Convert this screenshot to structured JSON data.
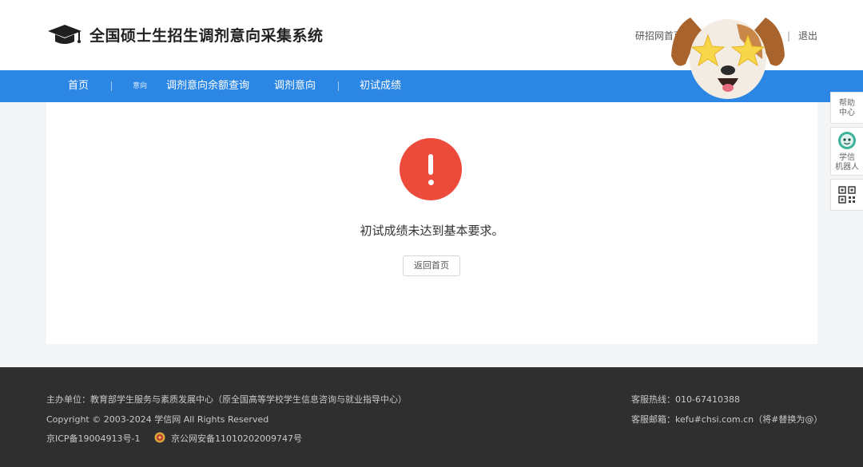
{
  "header": {
    "site_title": "全国硕士生招生调剂意向采集系统",
    "top_links": {
      "home": "研招网首页",
      "separator": "|",
      "logout": "退出"
    }
  },
  "nav": {
    "items": [
      {
        "label": "首页"
      },
      {
        "label": "意向"
      },
      {
        "label": "调剂意向余额查询"
      },
      {
        "label": "调剂意向"
      },
      {
        "label": "初试成绩"
      }
    ]
  },
  "main": {
    "message": "初试成绩未达到基本要求。",
    "back_button": "返回首页"
  },
  "side_tools": {
    "help_line1": "帮助",
    "help_line2": "中心",
    "robot_line1": "学信",
    "robot_line2": "机器人"
  },
  "footer": {
    "organizer": "主办单位：教育部学生服务与素质发展中心（原全国高等学校学生信息咨询与就业指导中心）",
    "copyright": "Copyright © 2003-2024 学信网 All Rights Reserved",
    "icp": "京ICP备19004913号-1",
    "police": "京公网安备11010202009747号",
    "hotline": "客服热线：010-67410388",
    "email": "客服邮箱：kefu#chsi.com.cn（将#替换为@）"
  },
  "colors": {
    "nav_bg": "#2b86e4",
    "alert_red": "#ec4b3c",
    "footer_bg": "#2f2f2f",
    "page_bg": "#f4f5f7"
  },
  "icons": {
    "logo": "graduation-cap-icon",
    "alert": "exclamation-icon",
    "robot": "robot-avatar-icon",
    "qr": "qr-code-icon",
    "police": "police-badge-icon",
    "sticker": "puppy-star-eyes-sticker"
  }
}
